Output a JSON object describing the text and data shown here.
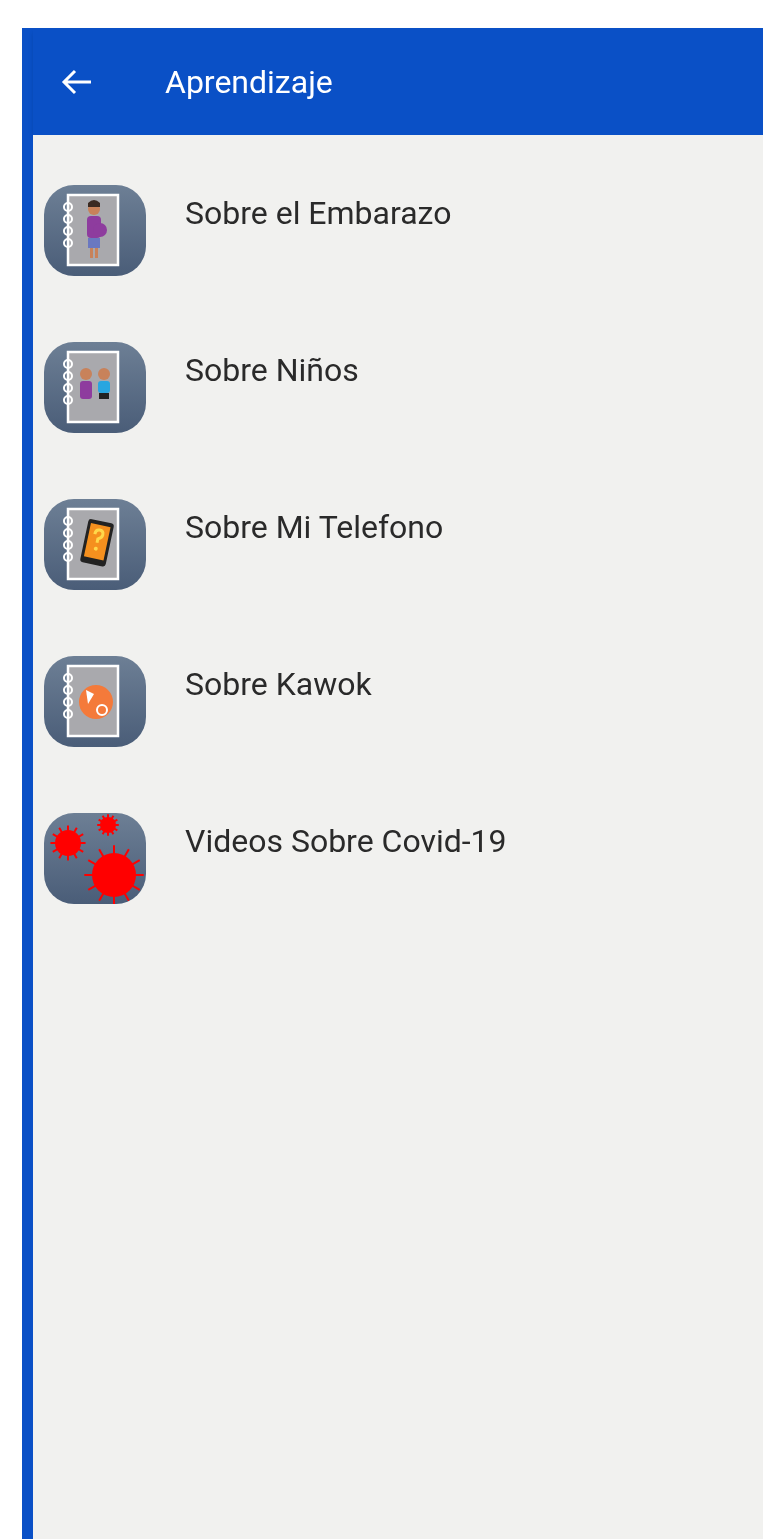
{
  "header": {
    "title": "Aprendizaje"
  },
  "items": [
    {
      "label": "Sobre el Embarazo",
      "kind": "pregnancy"
    },
    {
      "label": "Sobre Niños",
      "kind": "children"
    },
    {
      "label": "Sobre Mi Telefono",
      "kind": "phone"
    },
    {
      "label": "Sobre Kawok",
      "kind": "logo"
    },
    {
      "label": "Videos Sobre Covid-19",
      "kind": "virus"
    }
  ]
}
